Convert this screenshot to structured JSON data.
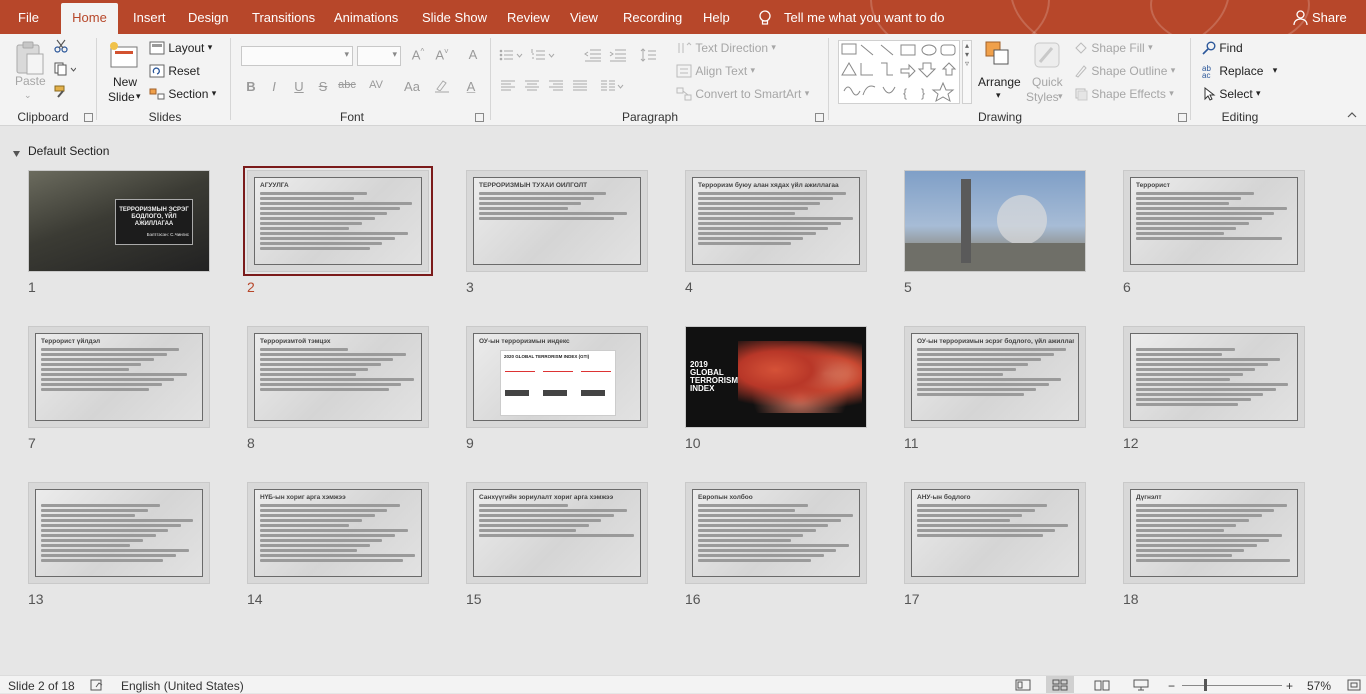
{
  "tabs": [
    "File",
    "Home",
    "Insert",
    "Design",
    "Transitions",
    "Animations",
    "Slide Show",
    "Review",
    "View",
    "Recording",
    "Help"
  ],
  "active_tab": "Home",
  "tell_me": "Tell me what you want to do",
  "share": "Share",
  "clipboard": {
    "paste": "Paste",
    "label": "Clipboard"
  },
  "slides_group": {
    "new_slide_1": "New",
    "new_slide_2": "Slide",
    "layout": "Layout",
    "reset": "Reset",
    "section": "Section",
    "label": "Slides"
  },
  "font_group": {
    "label": "Font",
    "font_value": "",
    "size_value": "",
    "bold": "B",
    "italic": "I",
    "underline": "U",
    "strike": "S",
    "shadow": "abc",
    "spacing": "AV",
    "case": "Aa",
    "color": "A",
    "clear": "A"
  },
  "paragraph_group": {
    "label": "Paragraph",
    "text_direction": "Text Direction",
    "align_text": "Align Text",
    "convert_smartart": "Convert to SmartArt"
  },
  "drawing_group": {
    "label": "Drawing",
    "arrange": "Arrange",
    "quick_styles_1": "Quick",
    "quick_styles_2": "Styles",
    "shape_fill": "Shape Fill",
    "shape_outline": "Shape Outline",
    "shape_effects": "Shape Effects"
  },
  "editing_group": {
    "label": "Editing",
    "find": "Find",
    "replace": "Replace",
    "select": "Select"
  },
  "section_title": "Default Section",
  "slides": [
    {
      "num": "1",
      "title": "ТЕРРОРИЗМЫН ЭСРЭГ БОДЛОГО, ҮЙЛ АЖИЛЛАГАА",
      "sub": "Бэлтгэсэн: С.Чингис",
      "kind": "photo-dark",
      "lines": 0
    },
    {
      "num": "2",
      "title": "АГУУЛГА",
      "kind": "text",
      "lines": 12
    },
    {
      "num": "3",
      "title": "ТЕРРОРИЗМЫН ТУХАЙ ОЙЛГОЛТ",
      "kind": "text",
      "lines": 6
    },
    {
      "num": "4",
      "title": "Терроризм буюу алан хядах үйл ажиллагаа",
      "kind": "text",
      "lines": 11
    },
    {
      "num": "5",
      "title": "",
      "kind": "photo-city",
      "lines": 0
    },
    {
      "num": "6",
      "title": "Террорист",
      "kind": "text",
      "lines": 10
    },
    {
      "num": "7",
      "title": "Террорист үйлдэл",
      "kind": "text",
      "lines": 9
    },
    {
      "num": "8",
      "title": "Терроризмтой тэмцэх",
      "kind": "text",
      "lines": 9
    },
    {
      "num": "9",
      "title": "ОУ-ын терроризмын индекс",
      "sub": "2020 GLOBAL TERRORISM INDEX (GTI)",
      "kind": "gti",
      "lines": 0
    },
    {
      "num": "10",
      "title": "2019 GLOBAL TERRORISM INDEX",
      "kind": "map",
      "lines": 0
    },
    {
      "num": "11",
      "title": "ОУ-ын терроризмын эсрэг бодлого, үйл ажиллагаа",
      "kind": "text",
      "lines": 10
    },
    {
      "num": "12",
      "title": "",
      "kind": "text",
      "lines": 12
    },
    {
      "num": "13",
      "title": "",
      "kind": "text",
      "lines": 12
    },
    {
      "num": "14",
      "title": "НҮБ-ын хориг арга хэмжээ",
      "kind": "text",
      "lines": 12
    },
    {
      "num": "15",
      "title": "Санхүүгийн зориулалт хориг арга хэмжээ",
      "kind": "text",
      "lines": 7
    },
    {
      "num": "16",
      "title": "Европын холбоо",
      "kind": "text",
      "lines": 12
    },
    {
      "num": "17",
      "title": "АНУ-ын бодлого",
      "kind": "text",
      "lines": 7
    },
    {
      "num": "18",
      "title": "Дүгнэлт",
      "kind": "text",
      "lines": 12
    }
  ],
  "status": {
    "slide_info": "Slide 2 of 18",
    "language": "English (United States)",
    "zoom": "57%"
  },
  "colors": {
    "accent": "#b7472a",
    "selection": "#7b1b1b"
  }
}
